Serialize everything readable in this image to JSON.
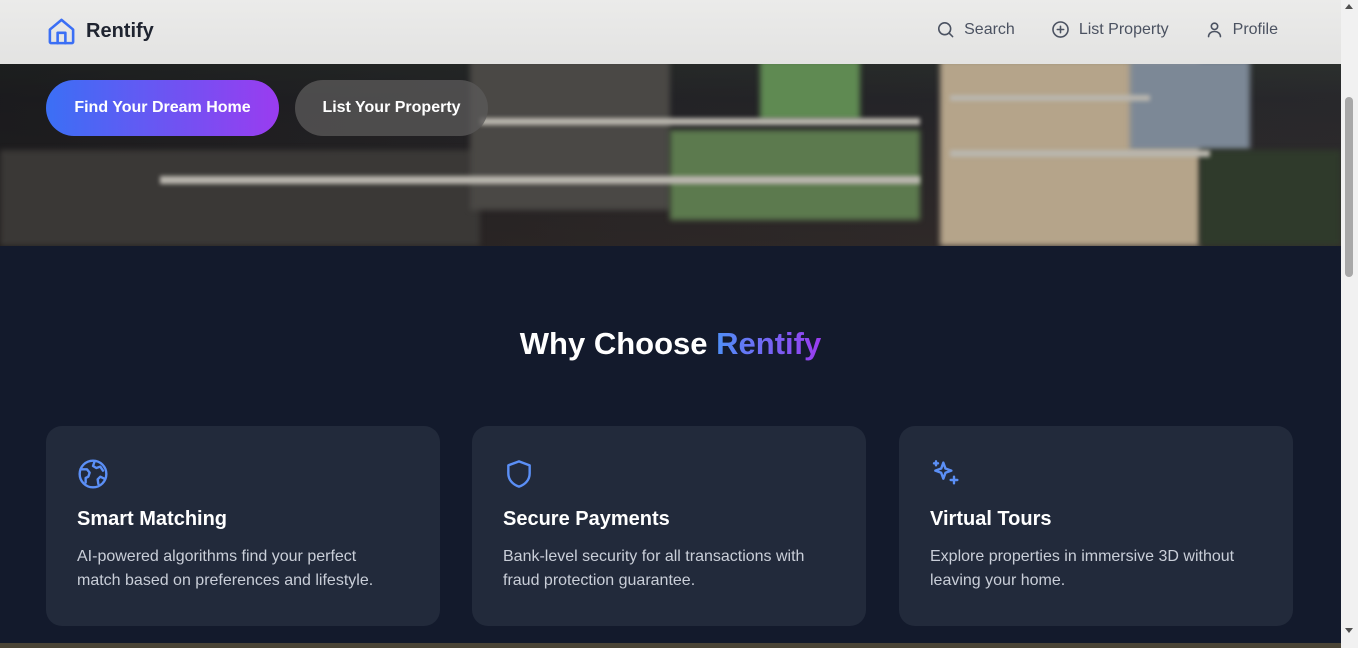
{
  "header": {
    "brand": "Rentify",
    "brand_icon": "home-icon",
    "nav": [
      {
        "label": "Search",
        "icon": "search-icon"
      },
      {
        "label": "List Property",
        "icon": "plus-circle-icon"
      },
      {
        "label": "Profile",
        "icon": "user-icon"
      }
    ]
  },
  "hero": {
    "primary_button": "Find Your Dream Home",
    "secondary_button": "List Your Property"
  },
  "features": {
    "title_prefix": "Why Choose",
    "title_accent": "Rentify",
    "cards": [
      {
        "icon": "globe-icon",
        "title": "Smart Matching",
        "description": "AI-powered algorithms find your perfect match based on preferences and lifestyle."
      },
      {
        "icon": "shield-icon",
        "title": "Secure Payments",
        "description": "Bank-level security for all transactions with fraud protection guarantee."
      },
      {
        "icon": "sparkles-icon",
        "title": "Virtual Tours",
        "description": "Explore properties in immersive 3D without leaving your home."
      }
    ]
  },
  "colors": {
    "accent_blue": "#3b6ff5",
    "accent_purple": "#9a3cf0",
    "background": "#131a2c",
    "card": "#222a3b",
    "icon": "#5b8ff6"
  }
}
